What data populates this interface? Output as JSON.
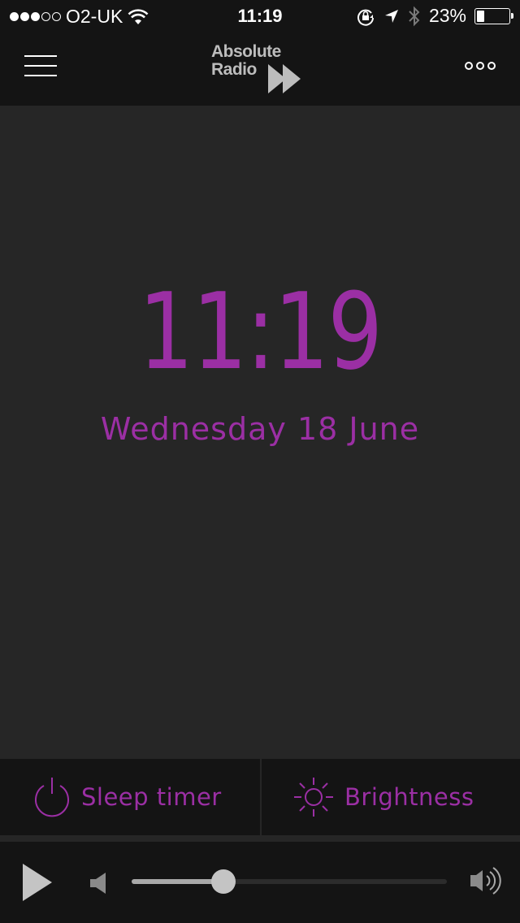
{
  "status_bar": {
    "signal_bars_filled": 3,
    "signal_bars_total": 5,
    "carrier": "O2-UK",
    "time": "11:19",
    "battery_percent_label": "23%",
    "battery_level": 0.23,
    "icons": [
      "wifi-icon",
      "rotation-lock-icon",
      "location-arrow-icon",
      "bluetooth-icon",
      "battery-icon"
    ]
  },
  "nav": {
    "menu_icon": "hamburger-menu-icon",
    "logo_line1": "Absolute",
    "logo_line2": "Radio",
    "more_icon": "more-options-icon"
  },
  "clock": {
    "time": "11:19",
    "date": "Wednesday 18 June"
  },
  "actions": {
    "sleep_timer": {
      "label": "Sleep timer",
      "icon": "power-icon"
    },
    "brightness": {
      "label": "Brightness",
      "icon": "sun-icon"
    }
  },
  "player": {
    "play_icon": "play-icon",
    "volume_low_icon": "volume-low-icon",
    "volume_high_icon": "volume-high-icon",
    "volume_level": 0.29
  },
  "colors": {
    "accent": "#9b2fa4",
    "bar_bg": "#141414",
    "main_bg": "#262626"
  }
}
